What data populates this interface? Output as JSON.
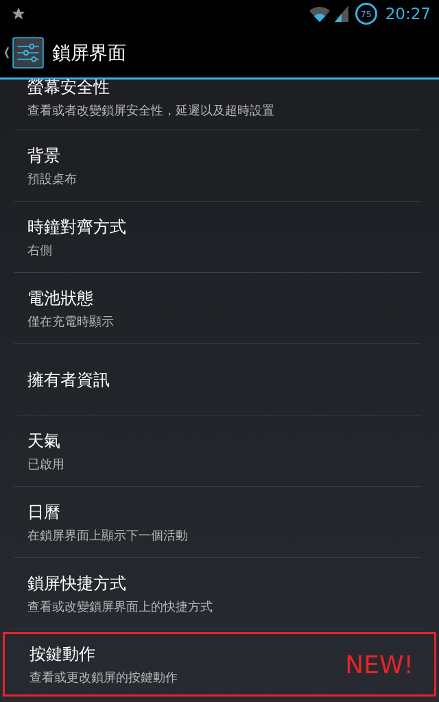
{
  "status_bar": {
    "battery": "75",
    "time": "20:27"
  },
  "action_bar": {
    "title": "鎖屏界面"
  },
  "items": [
    {
      "title": "螢幕安全性",
      "summary": "查看或者改變鎖屏安全性，延遲以及超時設置"
    },
    {
      "title": "背景",
      "summary": "預設桌布"
    },
    {
      "title": "時鐘對齊方式",
      "summary": "右側"
    },
    {
      "title": "電池狀態",
      "summary": "僅在充電時顯示"
    },
    {
      "title": "擁有者資訊"
    },
    {
      "title": "天氣",
      "summary": "已啟用"
    },
    {
      "title": "日曆",
      "summary": "在鎖屏界面上顯示下一個活動"
    },
    {
      "title": "鎖屏快捷方式",
      "summary": "查看或改變鎖屏界面上的快捷方式"
    },
    {
      "title": "按鍵動作",
      "summary": "查看或更改鎖屏的按鍵動作",
      "badge": "NEW!"
    }
  ]
}
